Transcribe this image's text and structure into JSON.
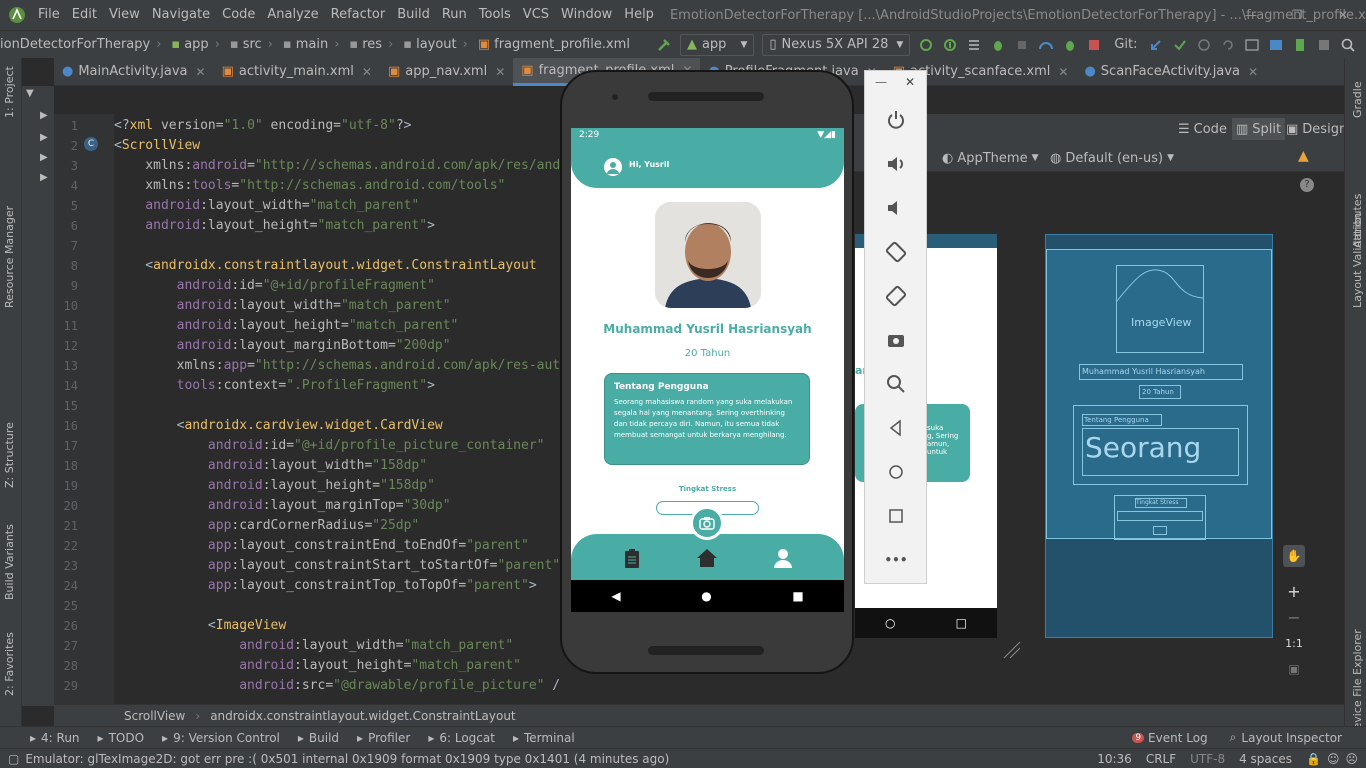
{
  "menu": [
    "File",
    "Edit",
    "View",
    "Navigate",
    "Code",
    "Analyze",
    "Refactor",
    "Build",
    "Run",
    "Tools",
    "VCS",
    "Window",
    "Help"
  ],
  "window_title": "EmotionDetectorForTherapy [...\\AndroidStudioProjects\\EmotionDetectorForTherapy] - ...\\fragment_profile.xml [app]",
  "breadcrumb": {
    "project": "ionDetectorForTherapy",
    "module": "app",
    "src": "src",
    "main": "main",
    "res": "res",
    "layout": "layout",
    "file": "fragment_profile.xml"
  },
  "toolbar": {
    "run_config": "app",
    "device": "Nexus 5X API 28",
    "git_label": "Git:"
  },
  "tabs": [
    {
      "label": "MainActivity.java",
      "icon": "java-class-icon"
    },
    {
      "label": "activity_main.xml",
      "icon": "xml-file-icon"
    },
    {
      "label": "app_nav.xml",
      "icon": "xml-file-icon"
    },
    {
      "label": "fragment_profile.xml",
      "icon": "xml-file-icon",
      "active": true
    },
    {
      "label": "ProfileFragment.java",
      "icon": "java-class-icon"
    },
    {
      "label": "activity_scanface.xml",
      "icon": "xml-file-icon"
    },
    {
      "label": "ScanFaceActivity.java",
      "icon": "java-class-icon"
    }
  ],
  "design_modes": {
    "code": "Code",
    "split": "Split",
    "design": "Design"
  },
  "design_toolbar": {
    "theme": "AppTheme",
    "locale": "Default (en-us)"
  },
  "code_lines": [
    {
      "n": "1",
      "parts": [
        [
          "t-plain",
          "<?"
        ],
        [
          "t-tag",
          "xml "
        ],
        [
          "t-attr",
          "version="
        ],
        [
          "t-val",
          "\"1.0\""
        ],
        [
          "t-attr",
          " encoding="
        ],
        [
          "t-val",
          "\"utf-8\""
        ],
        [
          "t-plain",
          "?>"
        ]
      ]
    },
    {
      "n": "2",
      "parts": [
        [
          "t-plain",
          "<"
        ],
        [
          "t-tag",
          "ScrollView"
        ]
      ]
    },
    {
      "n": "3",
      "parts": [
        [
          "t-attr",
          "    xmlns:"
        ],
        [
          "t-ns",
          "android"
        ],
        [
          "t-attr",
          "="
        ],
        [
          "t-val",
          "\"http://schemas.android.com/apk/res/android\""
        ]
      ]
    },
    {
      "n": "4",
      "parts": [
        [
          "t-attr",
          "    xmlns:"
        ],
        [
          "t-ns",
          "tools"
        ],
        [
          "t-attr",
          "="
        ],
        [
          "t-val",
          "\"http://schemas.android.com/tools\""
        ]
      ]
    },
    {
      "n": "5",
      "parts": [
        [
          "t-ns",
          "    android"
        ],
        [
          "t-attr",
          ":layout_width="
        ],
        [
          "t-val",
          "\"match_parent\""
        ]
      ]
    },
    {
      "n": "6",
      "parts": [
        [
          "t-ns",
          "    android"
        ],
        [
          "t-attr",
          ":layout_height="
        ],
        [
          "t-val",
          "\"match_parent\""
        ],
        [
          "t-plain",
          ">"
        ]
      ]
    },
    {
      "n": "7",
      "parts": [
        [
          "t-plain",
          ""
        ]
      ]
    },
    {
      "n": "8",
      "parts": [
        [
          "t-plain",
          "    <"
        ],
        [
          "t-tag",
          "androidx.constraintlayout.widget.ConstraintLayout"
        ]
      ]
    },
    {
      "n": "9",
      "parts": [
        [
          "t-ns",
          "        android"
        ],
        [
          "t-attr",
          ":id="
        ],
        [
          "t-val",
          "\"@+id/profileFragment\""
        ]
      ]
    },
    {
      "n": "10",
      "parts": [
        [
          "t-ns",
          "        android"
        ],
        [
          "t-attr",
          ":layout_width="
        ],
        [
          "t-val",
          "\"match_parent\""
        ]
      ]
    },
    {
      "n": "11",
      "parts": [
        [
          "t-ns",
          "        android"
        ],
        [
          "t-attr",
          ":layout_height="
        ],
        [
          "t-val",
          "\"match_parent\""
        ]
      ]
    },
    {
      "n": "12",
      "parts": [
        [
          "t-ns",
          "        android"
        ],
        [
          "t-attr",
          ":layout_marginBottom="
        ],
        [
          "t-val",
          "\"200dp\""
        ]
      ]
    },
    {
      "n": "13",
      "parts": [
        [
          "t-attr",
          "        xmlns:"
        ],
        [
          "t-ns",
          "app"
        ],
        [
          "t-attr",
          "="
        ],
        [
          "t-val",
          "\"http://schemas.android.com/apk/res-auto\""
        ]
      ]
    },
    {
      "n": "14",
      "parts": [
        [
          "t-ns",
          "        tools"
        ],
        [
          "t-attr",
          ":context="
        ],
        [
          "t-val",
          "\".ProfileFragment\""
        ],
        [
          "t-plain",
          ">"
        ]
      ]
    },
    {
      "n": "15",
      "parts": [
        [
          "t-plain",
          ""
        ]
      ]
    },
    {
      "n": "16",
      "parts": [
        [
          "t-plain",
          "        <"
        ],
        [
          "t-tag",
          "androidx.cardview.widget.CardView"
        ]
      ]
    },
    {
      "n": "17",
      "parts": [
        [
          "t-ns",
          "            android"
        ],
        [
          "t-attr",
          ":id="
        ],
        [
          "t-val",
          "\"@+id/profile_picture_container\""
        ]
      ]
    },
    {
      "n": "18",
      "parts": [
        [
          "t-ns",
          "            android"
        ],
        [
          "t-attr",
          ":layout_width="
        ],
        [
          "t-val",
          "\"158dp\""
        ]
      ]
    },
    {
      "n": "19",
      "parts": [
        [
          "t-ns",
          "            android"
        ],
        [
          "t-attr",
          ":layout_height="
        ],
        [
          "t-val",
          "\"158dp\""
        ]
      ]
    },
    {
      "n": "20",
      "parts": [
        [
          "t-ns",
          "            android"
        ],
        [
          "t-attr",
          ":layout_marginTop="
        ],
        [
          "t-val",
          "\"30dp\""
        ]
      ]
    },
    {
      "n": "21",
      "parts": [
        [
          "t-ns",
          "            app"
        ],
        [
          "t-attr",
          ":cardCornerRadius="
        ],
        [
          "t-val",
          "\"25dp\""
        ]
      ]
    },
    {
      "n": "22",
      "parts": [
        [
          "t-ns",
          "            app"
        ],
        [
          "t-attr",
          ":layout_constraintEnd_toEndOf="
        ],
        [
          "t-val",
          "\"parent\""
        ]
      ]
    },
    {
      "n": "23",
      "parts": [
        [
          "t-ns",
          "            app"
        ],
        [
          "t-attr",
          ":layout_constraintStart_toStartOf="
        ],
        [
          "t-val",
          "\"parent\""
        ]
      ]
    },
    {
      "n": "24",
      "parts": [
        [
          "t-ns",
          "            app"
        ],
        [
          "t-attr",
          ":layout_constraintTop_toTopOf="
        ],
        [
          "t-val",
          "\"parent\""
        ],
        [
          "t-plain",
          ">"
        ]
      ]
    },
    {
      "n": "25",
      "parts": [
        [
          "t-plain",
          ""
        ]
      ]
    },
    {
      "n": "26",
      "parts": [
        [
          "t-plain",
          "            <"
        ],
        [
          "t-tag",
          "ImageView"
        ]
      ]
    },
    {
      "n": "27",
      "parts": [
        [
          "t-ns",
          "                android"
        ],
        [
          "t-attr",
          ":layout_width="
        ],
        [
          "t-val",
          "\"match_parent\""
        ]
      ]
    },
    {
      "n": "28",
      "parts": [
        [
          "t-ns",
          "                android"
        ],
        [
          "t-attr",
          ":layout_height="
        ],
        [
          "t-val",
          "\"match_parent\""
        ]
      ]
    },
    {
      "n": "29",
      "parts": [
        [
          "t-ns",
          "                android"
        ],
        [
          "t-attr",
          ":src="
        ],
        [
          "t-val",
          "\"@drawable/profile_picture\""
        ],
        [
          "t-plain",
          " />"
        ]
      ]
    }
  ],
  "emulator": {
    "time": "2:29",
    "greeting": "Hi, Yusril",
    "name": "Muhammad Yusril Hasriansyah",
    "age": "20 Tahun",
    "about_title": "Tentang Pengguna",
    "about_text": "Seorang mahasiswa random yang suka melakukan segala hal yang menantang. Sering overthinking dan tidak percaya diri. Namun, itu semua tidak membuat semangat untuk berkarya menghilang.",
    "stress_label": "Tingkat Stress"
  },
  "preview": {
    "name_fragment": "ansyah",
    "card_fragment": "suka\ng, Sering\namun,\nuntuk"
  },
  "blueprint": {
    "image_label": "ImageView",
    "name": "Muhammad Yusril Hasriansyah",
    "age": "20 Tahun",
    "about_title": "Tentang Pengguna",
    "big_text": "Seorang",
    "stress": "Tingkat Stress"
  },
  "zoom": {
    "ratio": "1:1"
  },
  "bottom_breadcrumb": [
    "ScrollView",
    "androidx.constraintlayout.widget.ConstraintLayout"
  ],
  "tool_windows": [
    {
      "label": "4: Run",
      "icon": "run-icon"
    },
    {
      "label": "TODO",
      "icon": "todo-icon"
    },
    {
      "label": "9: Version Control",
      "icon": "vcs-icon"
    },
    {
      "label": "Build",
      "icon": "build-icon"
    },
    {
      "label": "Profiler",
      "icon": "profiler-icon"
    },
    {
      "label": "6: Logcat",
      "icon": "logcat-icon"
    },
    {
      "label": "Terminal",
      "icon": "terminal-icon"
    }
  ],
  "right_tools": {
    "event_log": "Event Log",
    "event_count": "9",
    "layout_inspector": "Layout Inspector"
  },
  "status": {
    "message": "Emulator: glTexImage2D: got err pre :( 0x501 internal 0x1909 format 0x1909 type 0x1401 (4 minutes ago)",
    "position": "10:36",
    "line_sep": "CRLF",
    "encoding": "UTF-8",
    "indent": "4 spaces"
  },
  "side_labels": {
    "project": "1: Project",
    "resource": "Resource Manager",
    "structure": "Z: Structure",
    "variants": "Build Variants",
    "favorites": "2: Favorites",
    "gradle": "Gradle",
    "attributes": "Attributes",
    "validation": "Layout Validation",
    "explorer": "Device File Explorer"
  },
  "colors": {
    "teal": "#4aada5",
    "ide_bg": "#2b2b2b",
    "panel": "#3c3f41",
    "accent": "#4a88c7"
  }
}
